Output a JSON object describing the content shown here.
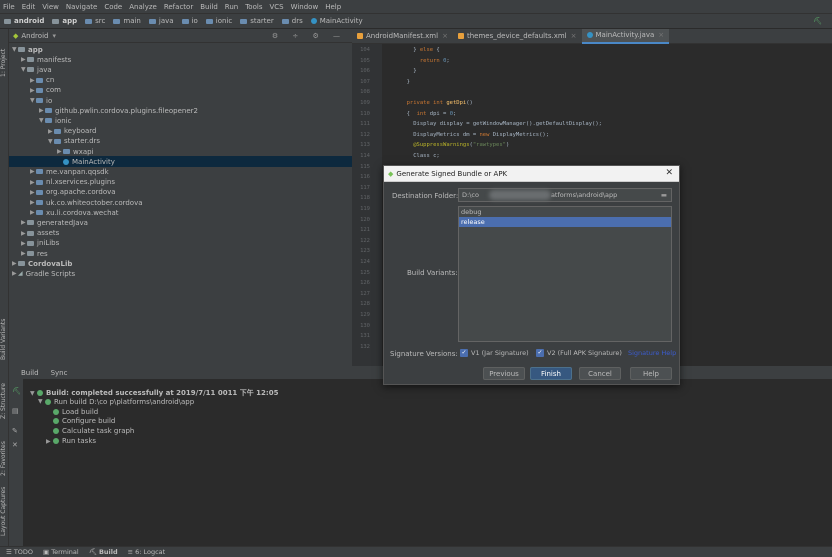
{
  "menubar": [
    "File",
    "Edit",
    "View",
    "Navigate",
    "Code",
    "Analyze",
    "Refactor",
    "Build",
    "Run",
    "Tools",
    "VCS",
    "Window",
    "Help"
  ],
  "breadcrumbs": [
    "android",
    "app",
    "src",
    "main",
    "java",
    "io",
    "ionic",
    "starter",
    "drs",
    "MainActivity"
  ],
  "project": {
    "view": "Android",
    "vtab": "1: Project",
    "tree": [
      {
        "label": "app",
        "level": 0,
        "open": true,
        "bold": true
      },
      {
        "label": "manifests",
        "level": 1,
        "open": false
      },
      {
        "label": "java",
        "level": 1,
        "open": true
      },
      {
        "label": "cn",
        "level": 2,
        "open": false
      },
      {
        "label": "com",
        "level": 2,
        "open": false
      },
      {
        "label": "io",
        "level": 2,
        "open": true
      },
      {
        "label": "github.pwlin.cordova.plugins.fileopener2",
        "level": 3,
        "open": false
      },
      {
        "label": "ionic",
        "level": 3,
        "open": true
      },
      {
        "label": "keyboard",
        "level": 4,
        "open": false
      },
      {
        "label": "starter.drs",
        "level": 4,
        "open": true
      },
      {
        "label": "wxapi",
        "level": 5,
        "open": false
      },
      {
        "label": "MainActivity",
        "level": 5,
        "leaf": true,
        "selected": true
      },
      {
        "label": "me.vanpan.qqsdk",
        "level": 2,
        "open": false
      },
      {
        "label": "nl.xservices.plugins",
        "level": 2,
        "open": false
      },
      {
        "label": "org.apache.cordova",
        "level": 2,
        "open": false
      },
      {
        "label": "uk.co.whiteoctober.cordova",
        "level": 2,
        "open": false
      },
      {
        "label": "xu.li.cordova.wechat",
        "level": 2,
        "open": false
      },
      {
        "label": "generatedJava",
        "level": 1,
        "open": false
      },
      {
        "label": "assets",
        "level": 1,
        "open": false
      },
      {
        "label": "jniLibs",
        "level": 1,
        "open": false
      },
      {
        "label": "res",
        "level": 1,
        "open": false
      },
      {
        "label": "CordovaLib",
        "level": 0,
        "open": false,
        "bold": true
      },
      {
        "label": "Gradle Scripts",
        "level": 0,
        "open": false
      }
    ]
  },
  "editor": {
    "tabs": [
      {
        "label": "AndroidManifest.xml",
        "active": false
      },
      {
        "label": "themes_device_defaults.xml",
        "active": false
      },
      {
        "label": "MainActivity.java",
        "active": true
      }
    ],
    "line_numbers": [
      "104",
      "105",
      "106",
      "107",
      "108",
      "109",
      "110",
      "111",
      "112",
      "113",
      "114",
      "115",
      "116",
      "117",
      "118",
      "119",
      "120",
      "121",
      "122",
      "123",
      "124",
      "125",
      "126",
      "127",
      "128",
      "129",
      "130",
      "131",
      "132"
    ],
    "code": [
      "    } else {",
      "      return 0;",
      "    }",
      "  }",
      "",
      "  private int getDpi()",
      "  {  int dpi = 0;",
      "    Display display = getWindowManager().getDefaultDisplay();",
      "    DisplayMetrics dm = new DisplayMetrics();",
      "    @SuppressWarnings(\"rawtypes\")",
      "    Class c;"
    ]
  },
  "dialog": {
    "title": "Generate Signed Bundle or APK",
    "dest_label": "Destination Folder:",
    "dest_prefix": "D:\\co",
    "dest_suffix": "atforms\\android\\app",
    "variants_label": "Build Variants:",
    "variants": [
      "debug",
      "release"
    ],
    "selected_variant": "release",
    "sig_label": "Signature Versions:",
    "v1": "V1 (Jar Signature)",
    "v2": "V2 (Full APK Signature)",
    "sig_help": "Signature Help",
    "buttons": {
      "previous": "Previous",
      "finish": "Finish",
      "cancel": "Cancel",
      "help": "Help"
    }
  },
  "build": {
    "tabs": [
      "Build",
      "Sync"
    ],
    "lines": [
      {
        "text": "Build: completed successfully  at 2019/7/11 0011 下午 12:05",
        "indent": 0,
        "bold": true
      },
      {
        "text": "Run build  D:\\co                     p\\platforms\\android\\app",
        "indent": 1
      },
      {
        "text": "Load build",
        "indent": 2
      },
      {
        "text": "Configure build",
        "indent": 2
      },
      {
        "text": "Calculate task graph",
        "indent": 2
      },
      {
        "text": "Run tasks",
        "indent": 2
      }
    ]
  },
  "left_vtabs": [
    "1: Project",
    "Build Variants",
    "Z: Structure",
    "2: Favorites",
    "Layout Captures"
  ],
  "statusbar": [
    "TODO",
    "Terminal",
    "Build",
    "6: Logcat"
  ],
  "colors": {
    "accent": "#4b6eaf",
    "success": "#59a869",
    "bg": "#2b2b2b",
    "panel": "#3c3f41"
  }
}
